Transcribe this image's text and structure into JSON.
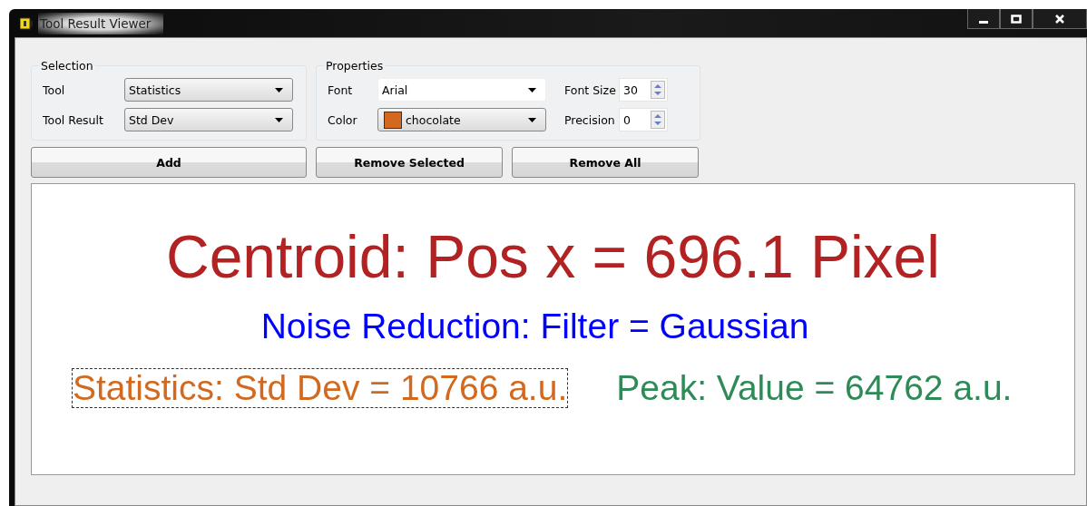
{
  "window": {
    "title": "Tool Result Viewer"
  },
  "selection": {
    "title": "Selection",
    "fields": [
      {
        "label": "Tool",
        "value": "Statistics"
      },
      {
        "label": "Tool Result",
        "value": "Std Dev"
      }
    ]
  },
  "properties": {
    "title": "Properties",
    "font": {
      "label": "Font",
      "value": "Arial"
    },
    "color": {
      "label": "Color",
      "value": "chocolate",
      "color": "#d2691e"
    },
    "font_size": {
      "label": "Font Size",
      "value": "30"
    },
    "precision": {
      "label": "Precision",
      "value": "0"
    }
  },
  "buttons": [
    "Add",
    "Remove Selected",
    "Remove All"
  ],
  "result_lines": [
    [
      {
        "text": "Centroid: Pos x = 696.1 Pixel",
        "color": "#b22222",
        "kind": "headline",
        "selected": false
      }
    ],
    [
      {
        "text": "Noise Reduction: Filter = Gaussian",
        "color": "#0000ff",
        "kind": "line",
        "selected": false
      }
    ],
    [
      {
        "text": "Statistics: Std Dev = 10766 a.u.",
        "color": "#d2691e",
        "kind": "line",
        "selected": true
      },
      {
        "text": "Peak: Value = 64762 a.u.",
        "color": "#2e8b57",
        "kind": "line",
        "selected": false
      }
    ]
  ]
}
